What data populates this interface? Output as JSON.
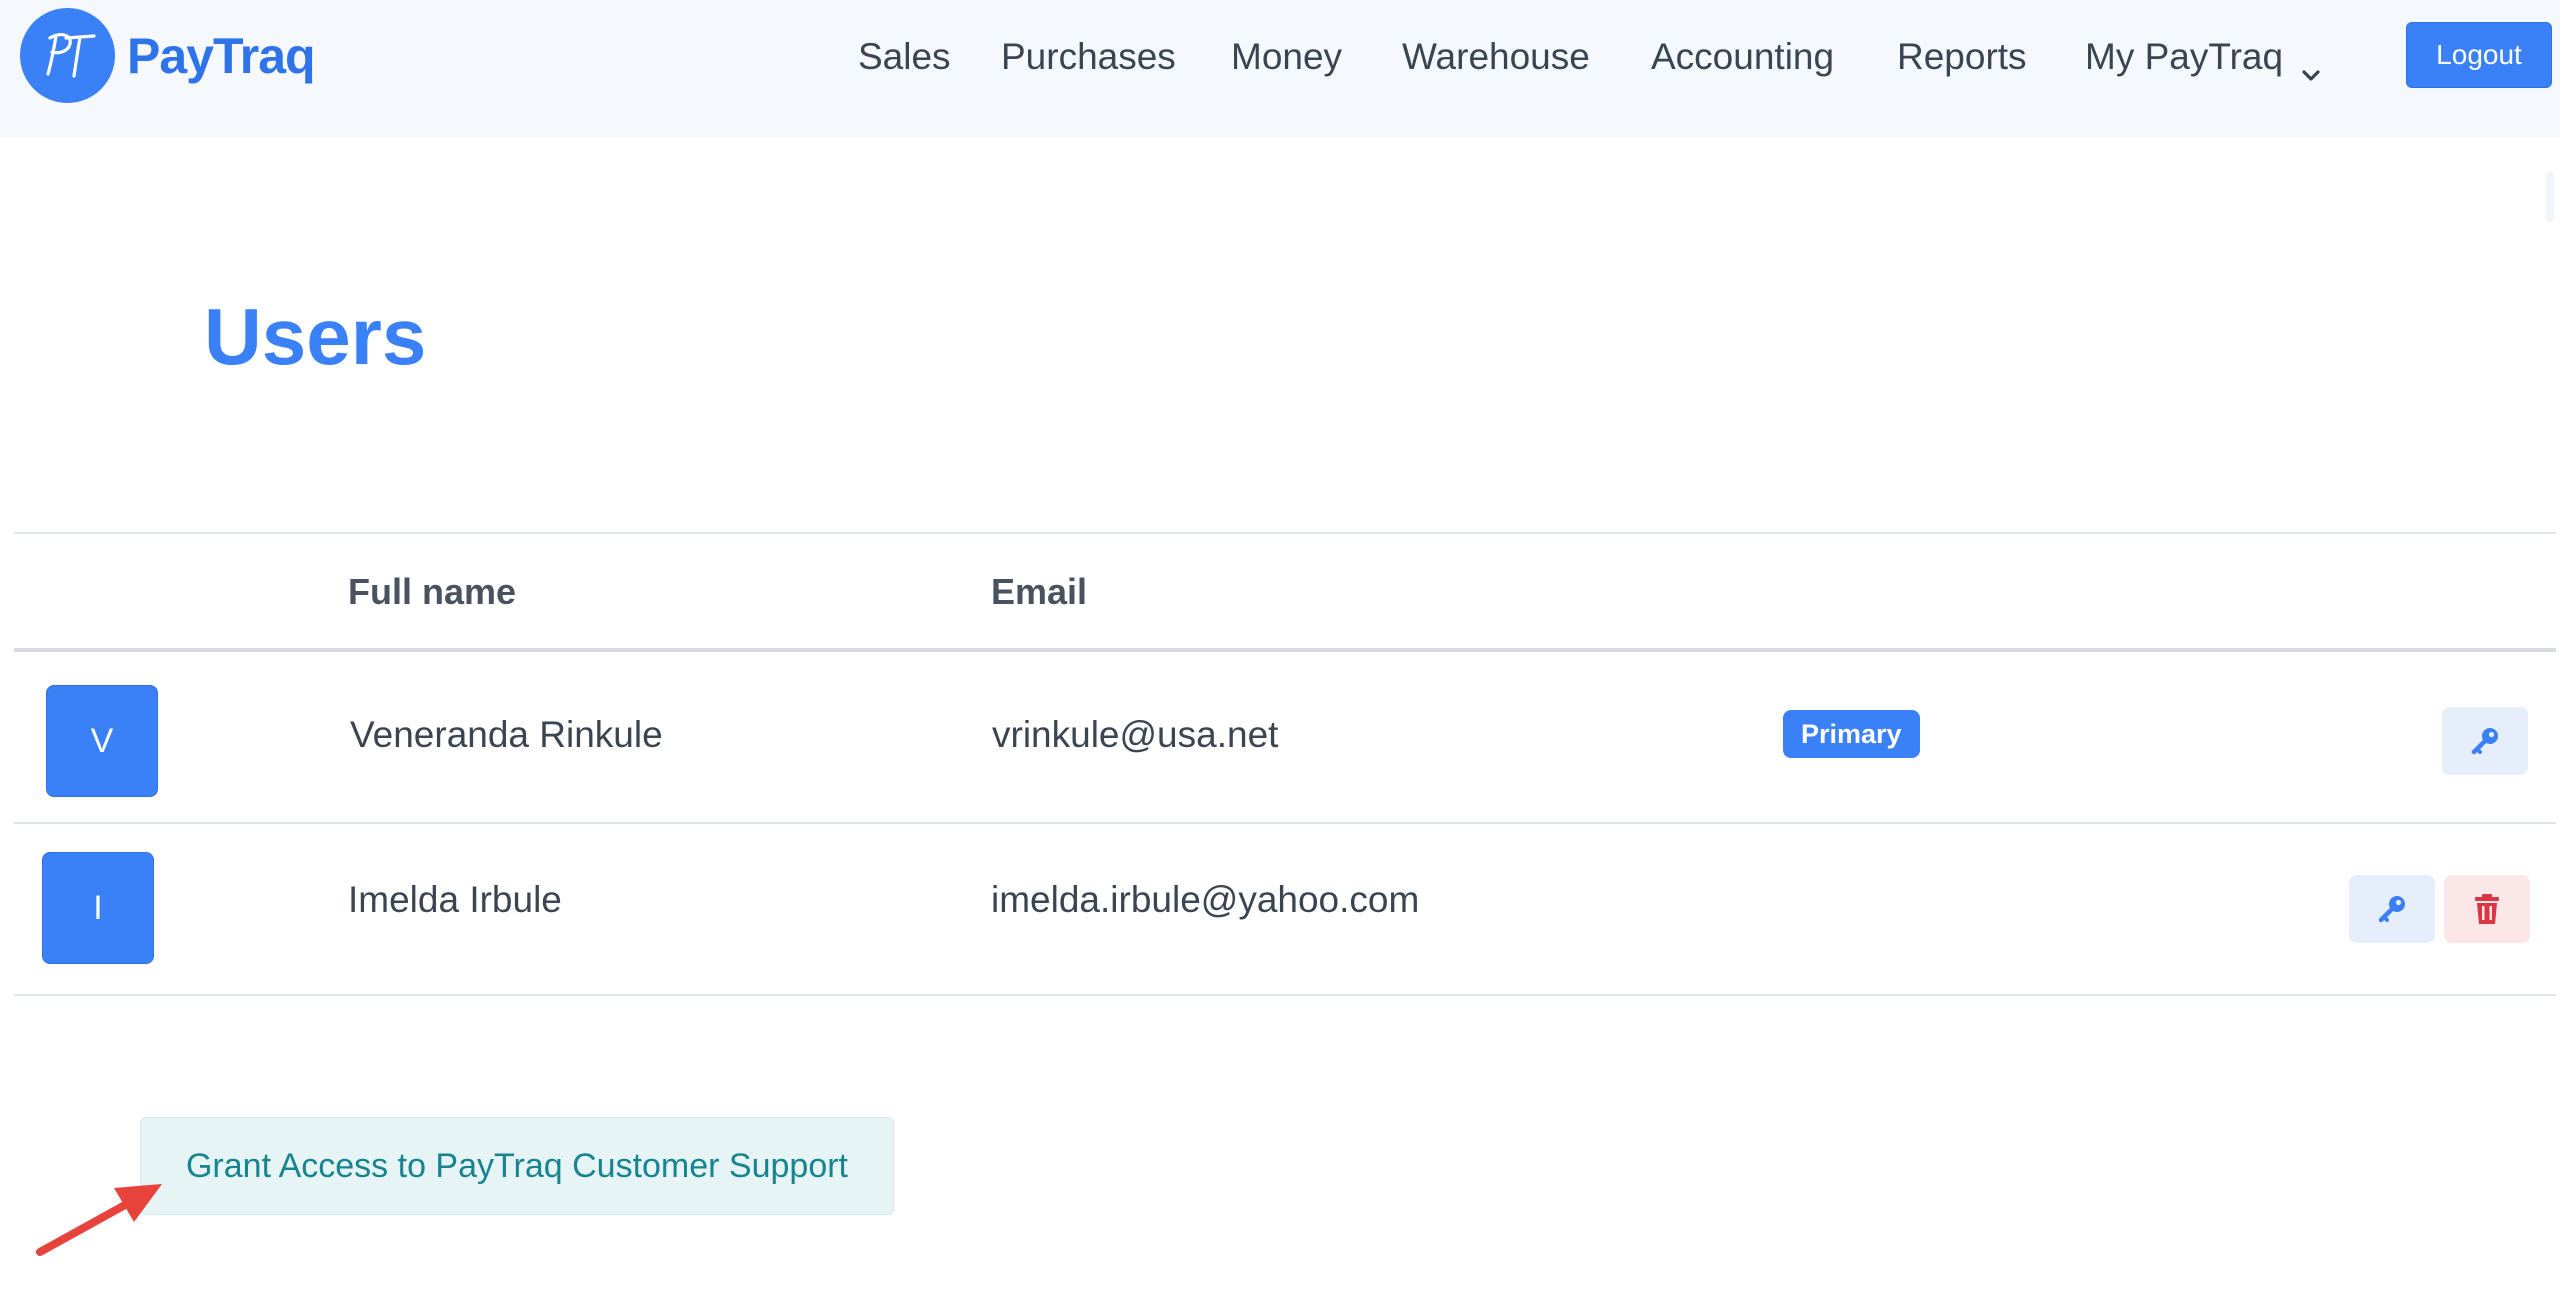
{
  "brand": {
    "logo_monogram": "PT",
    "name": "PayTraq",
    "color": "#3a80f6"
  },
  "nav": {
    "items": [
      {
        "label": "Sales"
      },
      {
        "label": "Purchases"
      },
      {
        "label": "Money"
      },
      {
        "label": "Warehouse"
      },
      {
        "label": "Accounting"
      },
      {
        "label": "Reports"
      },
      {
        "label": "My PayTraq",
        "has_dropdown": true
      }
    ],
    "logout_label": "Logout"
  },
  "page": {
    "title": "Users"
  },
  "users_table": {
    "columns": [
      "",
      "Full name",
      "Email",
      "",
      ""
    ],
    "rows": [
      {
        "avatar_initial": "V",
        "full_name": "Veneranda Rinkule",
        "email": "vrinkule@usa.net",
        "badge": "Primary",
        "actions": [
          "key-icon"
        ]
      },
      {
        "avatar_initial": "I",
        "full_name": "Imelda Irbule",
        "email": "imelda.irbule@yahoo.com",
        "badge": "",
        "actions": [
          "key-icon",
          "trash-icon"
        ]
      }
    ]
  },
  "support": {
    "grant_access_label": "Grant Access to PayTraq Customer Support"
  },
  "annotation": {
    "arrow_color": "#e8423c"
  },
  "colors": {
    "accent": "#3a80f6",
    "danger": "#dc3545",
    "teal": "#17848f",
    "topbar_bg": "#f5f9fe"
  }
}
